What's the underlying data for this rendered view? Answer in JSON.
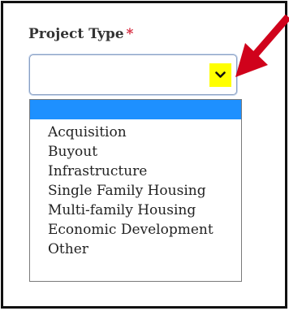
{
  "field": {
    "label": "Project Type",
    "required_mark": "*",
    "current_value": ""
  },
  "dropdown": {
    "selected_index": 0,
    "options": [
      "",
      "Acquisition",
      "Buyout",
      "Infrastructure",
      "Single Family Housing",
      "Multi-family Housing",
      "Economic Development",
      "Other"
    ]
  },
  "icons": {
    "toggle": "chevron-down-icon",
    "annotation": "red-arrow-icon"
  },
  "colors": {
    "required": "#d6263b",
    "selected_option": "#1e90ff",
    "highlight": "#ffff00",
    "annotation_arrow": "#d0021b"
  }
}
